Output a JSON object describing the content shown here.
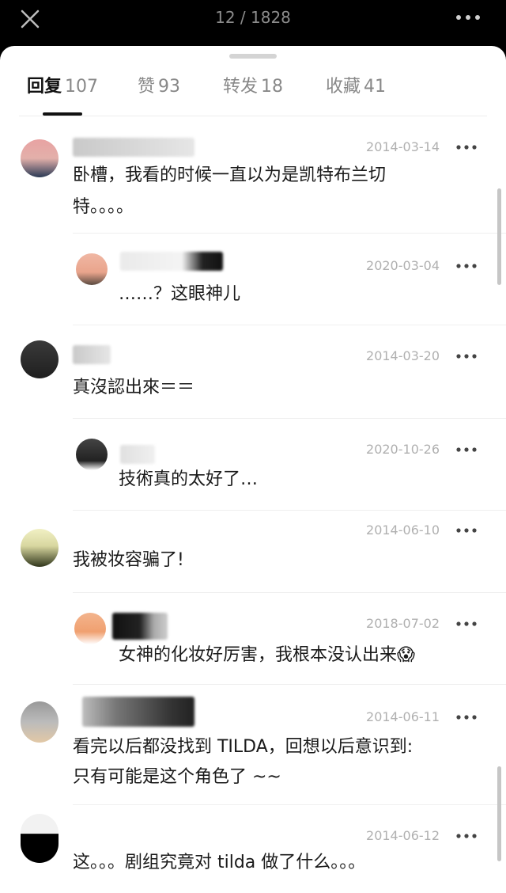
{
  "header": {
    "counter": "12 / 1828"
  },
  "tabs": [
    {
      "label": "回复",
      "count": "107",
      "active": true
    },
    {
      "label": "赞",
      "count": "93",
      "active": false
    },
    {
      "label": "转发",
      "count": "18",
      "active": false
    },
    {
      "label": "收藏",
      "count": "41",
      "active": false
    }
  ],
  "comments": [
    {
      "date": "2014-03-14",
      "text1": "卧槽，我看的时候一直以为是凯特布兰切",
      "text2": "特。。。。"
    },
    {
      "date": "2020-03-04",
      "text1": "……？这眼神儿"
    },
    {
      "date": "2014-03-20",
      "text1": "真沒認出來＝＝"
    },
    {
      "date": "2020-10-26",
      "text1": "技術真的太好了…"
    },
    {
      "date": "2014-06-10",
      "text1": "我被妆容骗了!"
    },
    {
      "date": "2018-07-02",
      "text1": "女神的化妆好厉害，我根本没认出来😱"
    },
    {
      "date": "2014-06-11",
      "text1": "看完以后都没找到 TILDA，回想以后意识到:",
      "text2": "只有可能是这个角色了 ~~"
    },
    {
      "date": "2014-06-12",
      "text1": "这。。。剧组究竟对 tilda 做了什么。。。"
    }
  ],
  "icons": {
    "close": "close-icon",
    "more": "more-dots-icon"
  }
}
